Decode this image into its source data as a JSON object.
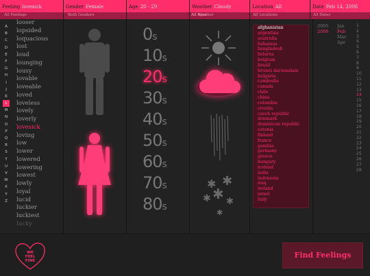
{
  "header": {
    "feeling": {
      "label": "Feeling",
      "value": "lovesick",
      "sub": "All Feelings"
    },
    "gender": {
      "label": "Gender",
      "value": "Female",
      "sub": "Both Genders"
    },
    "age": {
      "label": "Age",
      "value": "20 - 29",
      "sub": "All Ages"
    },
    "weather": {
      "label": "Weather",
      "value": "Cloudy",
      "sub": "All Weather"
    },
    "location": {
      "label": "Location",
      "value": "All",
      "sub": "All Locations"
    },
    "date": {
      "label": "Date",
      "value": "Feb 14, 2006",
      "sub": "All Dates"
    }
  },
  "alphabet": [
    "A",
    "B",
    "C",
    "D",
    "E",
    "F",
    "G",
    "H",
    "I",
    "J",
    "K",
    "L",
    "M",
    "N",
    "O",
    "P",
    "Q",
    "R",
    "S",
    "T",
    "U",
    "V",
    "W",
    "X",
    "Y",
    "Z"
  ],
  "alphabet_selected": "L",
  "feelings": [
    "looser",
    "lopsided",
    "loquacious",
    "lost",
    "loud",
    "lounging",
    "lousy",
    "lovable",
    "loveable",
    "loved",
    "loveless",
    "lovely",
    "loverly",
    "lovesick",
    "loving",
    "low",
    "lower",
    "lowered",
    "lowering",
    "lowest",
    "lowly",
    "loyal",
    "lucid",
    "luckier",
    "luckiest",
    "lucky"
  ],
  "feelings_selected": "lovesick",
  "ages": [
    {
      "num": "0",
      "suffix": "s"
    },
    {
      "num": "10",
      "suffix": "s"
    },
    {
      "num": "20",
      "suffix": "s"
    },
    {
      "num": "30",
      "suffix": "s"
    },
    {
      "num": "40",
      "suffix": "s"
    },
    {
      "num": "50",
      "suffix": "s"
    },
    {
      "num": "60",
      "suffix": "s"
    },
    {
      "num": "70",
      "suffix": "s"
    },
    {
      "num": "80",
      "suffix": "s"
    }
  ],
  "ages_selected": "20",
  "locations": [
    "afghanistan",
    "argentina",
    "australia",
    "bahamas",
    "bangladesh",
    "belarus",
    "belgium",
    "brazil",
    "brunei darussalam",
    "bulgaria",
    "cambodia",
    "canada",
    "chile",
    "china",
    "colombia",
    "croatia",
    "czech republic",
    "denmark",
    "dominican republic",
    "estonia",
    "finland",
    "france",
    "gambia",
    "germany",
    "greece",
    "hungary",
    "iceland",
    "india",
    "indonesia",
    "iraq",
    "ireland",
    "israel",
    "italy"
  ],
  "locations_selected": "afghanistan",
  "years": [
    "2005",
    "2006"
  ],
  "years_selected": "2006",
  "months": [
    "Jan",
    "Feb",
    "Mar",
    "Apr"
  ],
  "months_selected": "Feb",
  "days": [
    "1",
    "2",
    "3",
    "4",
    "5",
    "6",
    "7",
    "8",
    "9",
    "10",
    "11",
    "12",
    "13",
    "14",
    "15",
    "16",
    "17",
    "18",
    "19",
    "20",
    "21",
    "22",
    "23",
    "24",
    "25",
    "26",
    "27",
    "28"
  ],
  "days_selected": "14",
  "footer": {
    "logo_line1": "WE",
    "logo_line2": "FEEL",
    "logo_line3": "FINE",
    "find_button": "Find Feelings"
  },
  "colors": {
    "accent": "#ff2d6a",
    "dark_accent": "#9e1d45",
    "background": "#222222"
  },
  "icons": {
    "male": "male-figure-icon",
    "female": "female-figure-icon",
    "sunny": "sun-icon",
    "cloudy": "cloud-icon",
    "rainy": "rain-icon",
    "snowy": "snow-icon"
  }
}
